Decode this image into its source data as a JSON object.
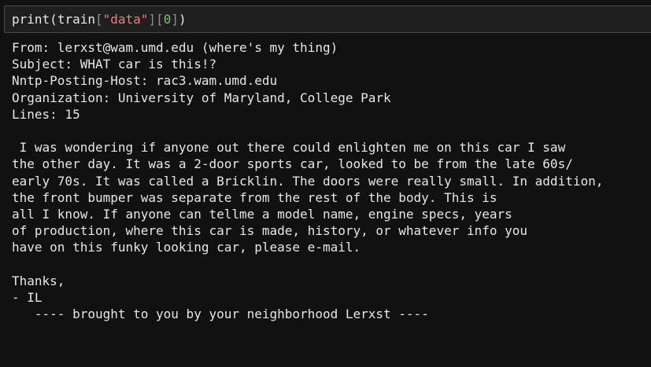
{
  "input_cell": {
    "fn": "print",
    "open_paren": "(",
    "var": "train",
    "open_bracket_1": "[",
    "key": "\"data\"",
    "close_bracket_1": "]",
    "open_bracket_2": "[",
    "index": "0",
    "close_bracket_2": "]",
    "close_paren": ")"
  },
  "colors": {
    "background": "#111111",
    "cell_background": "#1f1f1f",
    "string": "#f07c72",
    "number": "#7fbf6a"
  },
  "output": {
    "lines": [
      "From: lerxst@wam.umd.edu (where's my thing)",
      "Subject: WHAT car is this!?",
      "Nntp-Posting-Host: rac3.wam.umd.edu",
      "Organization: University of Maryland, College Park",
      "Lines: 15",
      "",
      " I was wondering if anyone out there could enlighten me on this car I saw",
      "the other day. It was a 2-door sports car, looked to be from the late 60s/",
      "early 70s. It was called a Bricklin. The doors were really small. In addition,",
      "the front bumper was separate from the rest of the body. This is",
      "all I know. If anyone can tellme a model name, engine specs, years",
      "of production, where this car is made, history, or whatever info you",
      "have on this funky looking car, please e-mail.",
      "",
      "Thanks,",
      "- IL",
      "   ---- brought to you by your neighborhood Lerxst ----"
    ]
  }
}
